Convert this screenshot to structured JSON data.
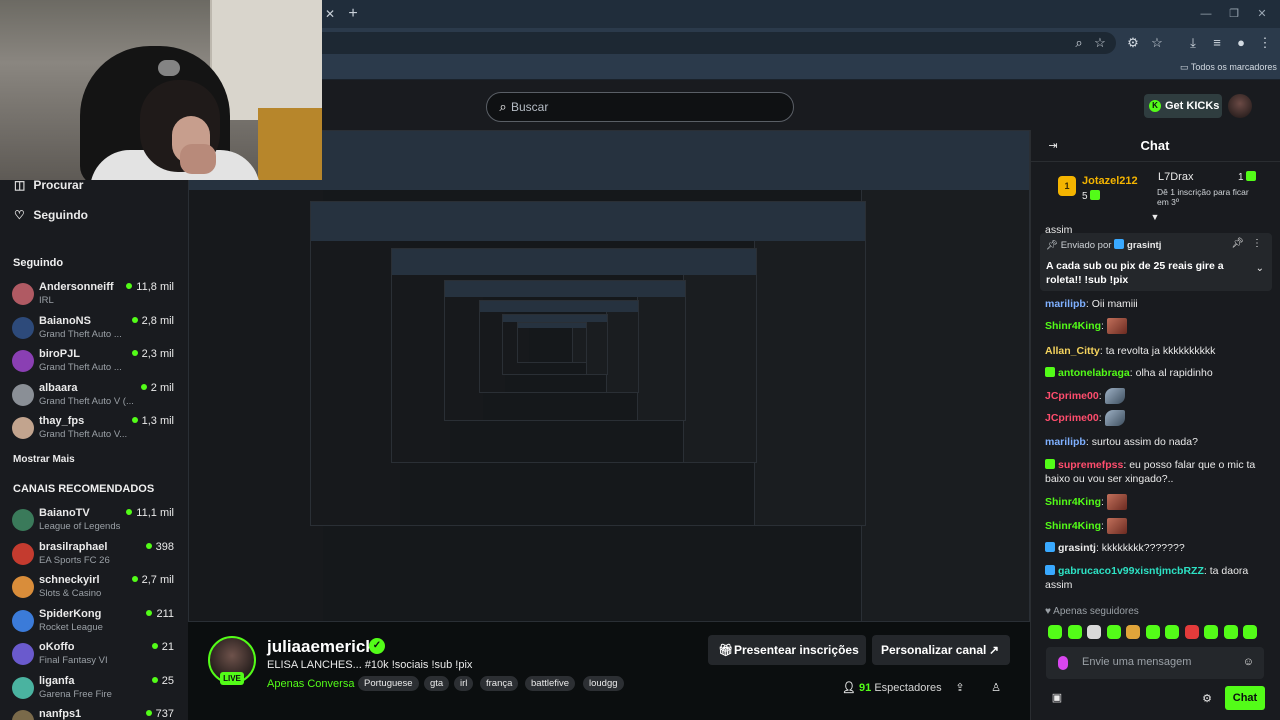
{
  "browser": {
    "bookmarks_folder": "Todos os marcadores"
  },
  "topnav": {
    "search_placeholder": "Buscar",
    "get_kicks_label": "Get KICKs"
  },
  "sidebar": {
    "nav": [
      {
        "label": "Procurar"
      },
      {
        "label": "Seguindo"
      }
    ],
    "following_title": "Seguindo",
    "following": [
      {
        "name": "Andersonneiff",
        "game": "IRL",
        "viewers": "11,8 mil"
      },
      {
        "name": "BaianoNS",
        "game": "Grand Theft Auto ...",
        "viewers": "2,8 mil"
      },
      {
        "name": "biroPJL",
        "game": "Grand Theft Auto ...",
        "viewers": "2,3 mil"
      },
      {
        "name": "albaara",
        "game": "Grand Theft Auto V (...",
        "viewers": "2 mil"
      },
      {
        "name": "thay_fps",
        "game": "Grand Theft Auto V...",
        "viewers": "1,3 mil"
      }
    ],
    "show_more": "Mostrar Mais",
    "recommended_title": "CANAIS RECOMENDADOS",
    "recommended": [
      {
        "name": "BaianoTV",
        "game": "League of Legends",
        "viewers": "11,1 mil"
      },
      {
        "name": "brasilraphael",
        "game": "EA Sports FC 26",
        "viewers": "398"
      },
      {
        "name": "schneckyirl",
        "game": "Slots & Casino",
        "viewers": "2,7 mil"
      },
      {
        "name": "SpiderKong",
        "game": "Rocket League",
        "viewers": "211"
      },
      {
        "name": "oKoffo",
        "game": "Final Fantasy VI",
        "viewers": "21"
      },
      {
        "name": "liganfa",
        "game": "Garena Free Fire",
        "viewers": "25"
      },
      {
        "name": "nanfps1",
        "game": "",
        "viewers": "737"
      }
    ]
  },
  "stream": {
    "streamer": "juliaaemerick",
    "live": "LIVE",
    "title": "ELISA LANCHES... #10k !sociais !sub !pix",
    "category": "Apenas Conversa",
    "tags": [
      "Portuguese",
      "gta",
      "irl",
      "frança",
      "battlefive",
      "loudgg"
    ],
    "gift_label": "Presentear inscrições",
    "customize_label": "Personalizar canal",
    "viewers_count": "91",
    "viewers_label": "Espectadores"
  },
  "chat": {
    "title": "Chat",
    "leaderboard": [
      {
        "rank": "1",
        "name": "Jotazel212",
        "count": "5"
      },
      {
        "name": "L7Drax",
        "count": "1",
        "note": "Dê 1 inscrição para ficar em 3º"
      }
    ],
    "partial_first": "assim",
    "pinned": {
      "sent_by": "Enviado por",
      "author": "grasintj",
      "text": "A cada sub ou pix de 25 reais gire a roleta!! !sub !pix"
    },
    "messages": [
      {
        "user": "marilipb",
        "text": "Oii mamiii",
        "color": "#7fb0ff"
      },
      {
        "user": "Shinr4King",
        "text": "",
        "color": "#53fc18",
        "emote": "face"
      },
      {
        "user": "Allan_Citty",
        "text": "ta revolta ja kkkkkkkkkk",
        "color": "#f4d35e"
      },
      {
        "user": "antonelabraga",
        "text": "olha al rapidinho",
        "color": "#53fc18"
      },
      {
        "user": "JCprime00",
        "text": "",
        "color": "#ff4d6d",
        "emote": "bird"
      },
      {
        "user": "JCprime00",
        "text": "",
        "color": "#ff4d6d",
        "emote": "bird"
      },
      {
        "user": "marilipb",
        "text": "surtou assim do nada?",
        "color": "#7fb0ff"
      },
      {
        "user": "supremefpss",
        "text": "eu posso falar que o mic ta baixo ou vou ser xingado?..",
        "color": "#ff4d6d"
      },
      {
        "user": "Shinr4King",
        "text": "",
        "color": "#53fc18",
        "emote": "face"
      },
      {
        "user": "Shinr4King",
        "text": "",
        "color": "#53fc18",
        "emote": "face"
      },
      {
        "user": "grasintj",
        "text": "kkkkkkkk???????",
        "color": "#eaeaea"
      },
      {
        "user": "gabrucaco1v99xisntjmcbRZZ",
        "text": "ta daora assim",
        "color": "#2de2c4"
      }
    ],
    "followers_only": "Apenas seguidores",
    "input_placeholder": "Envie uma mensagem",
    "send_label": "Chat"
  },
  "colors": {
    "accent": "#53fc18",
    "background": "#0b0e0f",
    "panel": "#191b1f"
  }
}
